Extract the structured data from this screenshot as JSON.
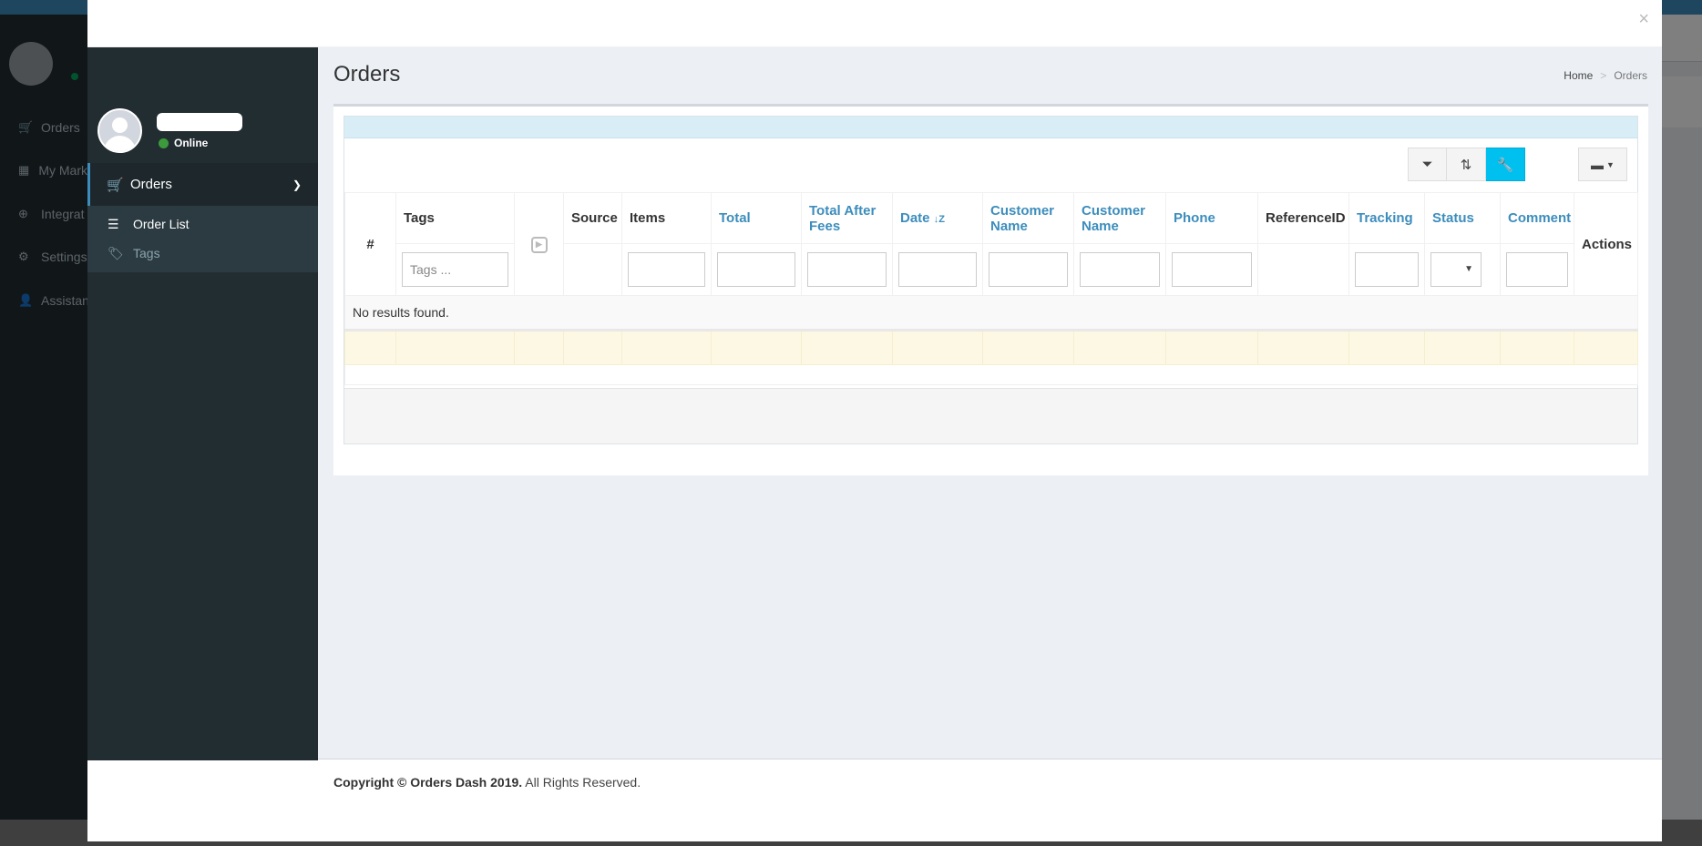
{
  "background_app": {
    "menu": [
      {
        "icon": "cart-icon",
        "label": "Orders"
      },
      {
        "icon": "building-icon",
        "label": "My Mark"
      },
      {
        "icon": "plus-circle-icon",
        "label": "Integrat"
      },
      {
        "icon": "gear-icon",
        "label": "Settings"
      },
      {
        "icon": "user-icon",
        "label": "Assistan"
      }
    ]
  },
  "modal": {
    "close_label": "×"
  },
  "sidebar": {
    "user_status": "Online",
    "nav": {
      "label": "Orders",
      "icon": "cart-icon",
      "items": [
        {
          "label": "Order List",
          "icon": "list-icon"
        },
        {
          "label": "Tags",
          "icon": "tags-icon"
        }
      ]
    }
  },
  "content": {
    "title": "Orders",
    "breadcrumb": {
      "home": "Home",
      "separator": ">",
      "current": "Orders"
    }
  },
  "grid": {
    "toolbar": {
      "filter_icon": "filter-icon",
      "sort_icon": "sort-icon",
      "wrench_icon": "wrench-icon",
      "export_icon": "export-icon"
    },
    "columns": {
      "num": "#",
      "tags": "Tags",
      "source": "Source",
      "items": "Items",
      "total": "Total",
      "total_after_fees": "Total After Fees",
      "date": "Date",
      "date_sort_icon": "↓Z",
      "customer_name_1": "Customer Name",
      "customer_name_2": "Customer Name",
      "phone": "Phone",
      "reference_id": "ReferenceID",
      "tracking": "Tracking",
      "status": "Status",
      "comment": "Comment",
      "actions": "Actions"
    },
    "filters": {
      "tags_placeholder": "Tags ..."
    },
    "empty_message": "No results found."
  },
  "footer": {
    "copyright_bold": "Copyright © Orders Dash 2019.",
    "rights": "All Rights Reserved."
  },
  "colors": {
    "link": "#3c8dbc",
    "sidebar_bg": "#222d32",
    "active_tool": "#00c0ef",
    "online": "#3c9a3c"
  }
}
